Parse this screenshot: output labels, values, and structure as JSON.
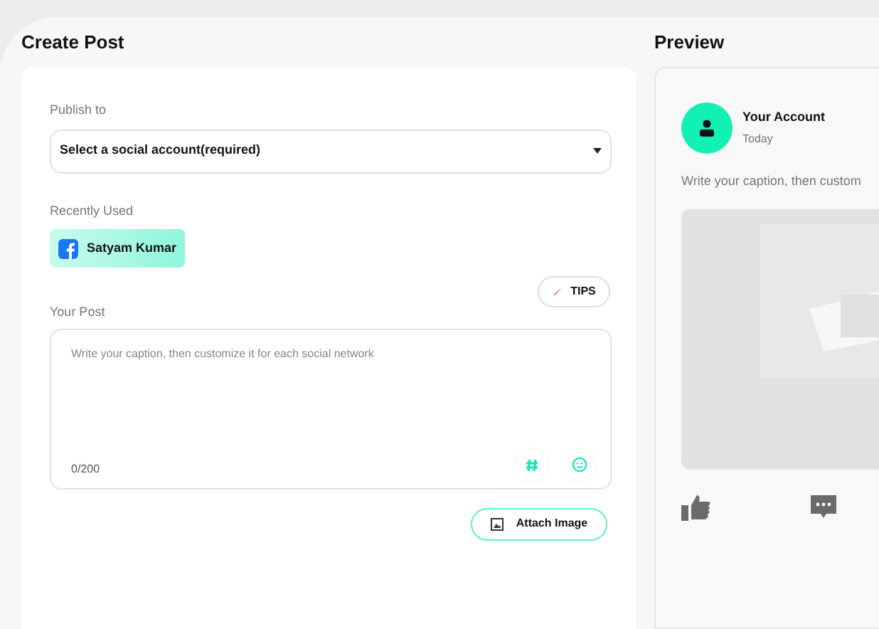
{
  "create_post": {
    "title": "Create Post",
    "publish_to": {
      "label": "Publish to",
      "placeholder": "Select a social account(required)"
    },
    "recently_used": {
      "label": "Recently Used",
      "accounts": [
        {
          "name": "Satyam Kumar",
          "selected": true
        }
      ]
    },
    "tips_button": "TIPS",
    "your_post": {
      "label": "Your Post",
      "placeholder": "Write your caption, then customize it for each social network",
      "counter": "0/200"
    },
    "attach_button": "Attach Image"
  },
  "preview": {
    "title": "Preview",
    "account": "Your Account",
    "time": "Today",
    "caption": "Write your caption, then custom"
  }
}
